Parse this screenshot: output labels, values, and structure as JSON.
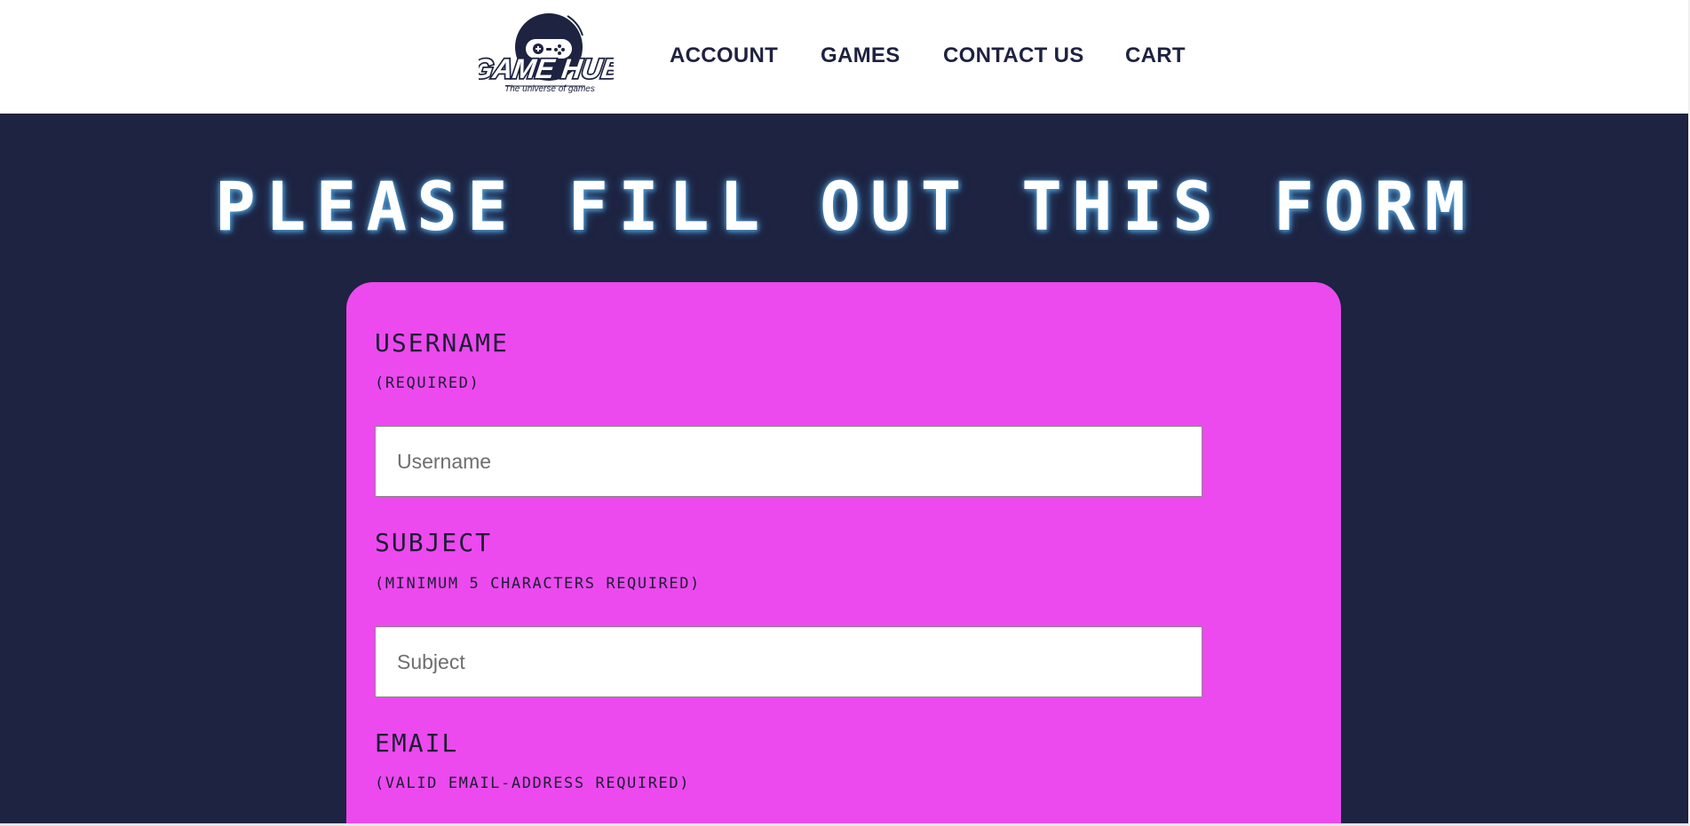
{
  "header": {
    "logo": {
      "title": "GAME HUB",
      "tagline": "The universe of games"
    },
    "nav": [
      {
        "label": "ACCOUNT"
      },
      {
        "label": "GAMES"
      },
      {
        "label": "CONTACT US"
      },
      {
        "label": "CART"
      }
    ]
  },
  "main": {
    "title": "PLEASE FILL OUT THIS FORM",
    "form": {
      "fields": [
        {
          "label": "USERNAME",
          "hint": "(REQUIRED)",
          "placeholder": "Username"
        },
        {
          "label": "SUBJECT",
          "hint": "(MINIMUM 5 CHARACTERS REQUIRED)",
          "placeholder": "Subject"
        },
        {
          "label": "EMAIL",
          "hint": "(VALID EMAIL-ADDRESS REQUIRED)"
        }
      ]
    }
  },
  "colors": {
    "header_bg": "#ffffff",
    "main_bg": "#1d2340",
    "card_bg": "#ec4aee",
    "nav_text": "#1e2240",
    "title_glow": "#5fa8d8"
  },
  "icons": {
    "logo": "gamepad-icon"
  }
}
